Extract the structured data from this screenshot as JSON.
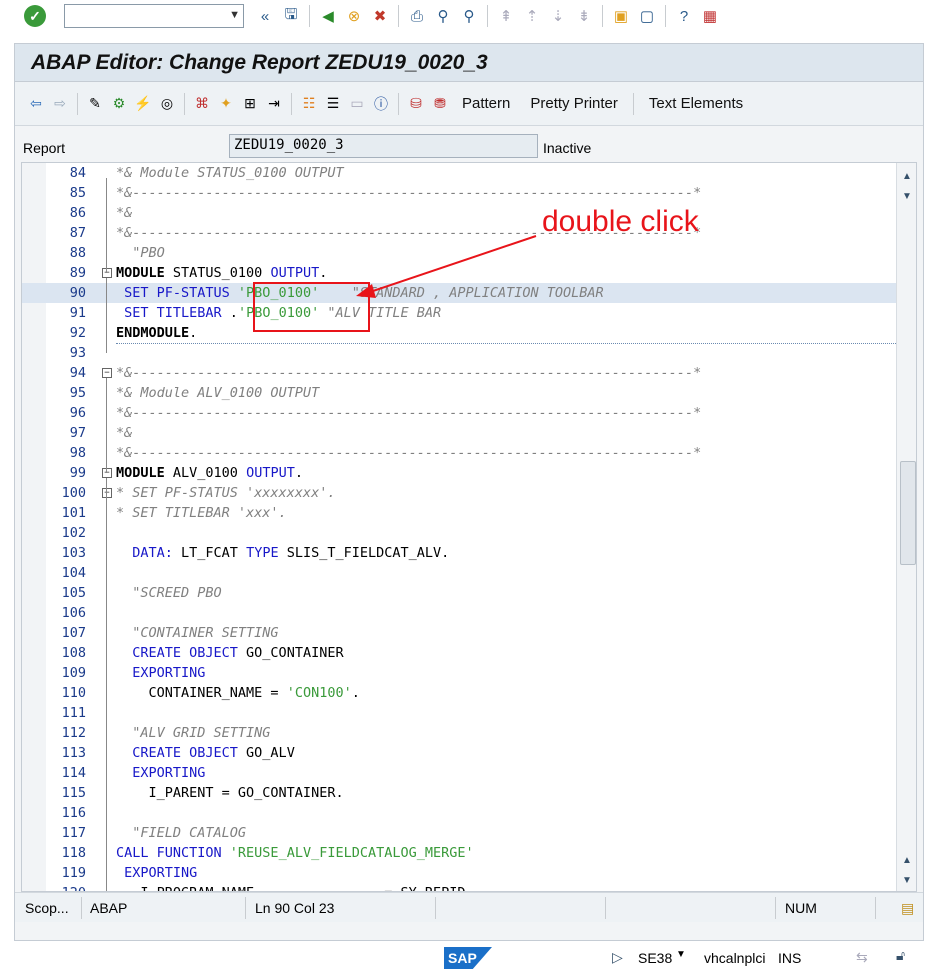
{
  "topbar": {
    "command_value": ""
  },
  "window": {
    "title": "ABAP Editor: Change Report ZEDU19_0020_3"
  },
  "toolbar": {
    "pattern": "Pattern",
    "pretty_printer": "Pretty Printer",
    "text_elements": "Text Elements"
  },
  "report": {
    "label": "Report",
    "value": "ZEDU19_0020_3",
    "status": "Inactive"
  },
  "lines": [
    {
      "n": "84",
      "text": "*& Module STATUS_0100 OUTPUT"
    },
    {
      "n": "85",
      "text": "*&---------------------------------------------------------------------*"
    },
    {
      "n": "86",
      "text": "*&"
    },
    {
      "n": "87",
      "text": "*&---------------------------------------------------------------------*"
    },
    {
      "n": "88",
      "text": "  \"PBO"
    },
    {
      "n": "89",
      "a": "MODULE",
      "b": " STATUS_0100 ",
      "c": "OUTPUT",
      "d": "."
    },
    {
      "n": "90",
      "a": " SET PF-STATUS ",
      "s": "'PBO_0100'",
      "cm": "    \"STANDARD , APPLICATION TOOLBAR"
    },
    {
      "n": "91",
      "a": " SET TITLEBAR ",
      "s": "'PBO_0100'",
      "d": ".",
      "cm": " \"ALV TITLE BAR"
    },
    {
      "n": "92",
      "a": "ENDMODULE",
      "d": "."
    },
    {
      "n": "93"
    },
    {
      "n": "94",
      "text": "*&---------------------------------------------------------------------*"
    },
    {
      "n": "95",
      "text": "*& Module ALV_0100 OUTPUT"
    },
    {
      "n": "96",
      "text": "*&---------------------------------------------------------------------*"
    },
    {
      "n": "97",
      "text": "*&"
    },
    {
      "n": "98",
      "text": "*&---------------------------------------------------------------------*"
    },
    {
      "n": "99",
      "a": "MODULE",
      "b": " ALV_0100 ",
      "c": "OUTPUT",
      "d": "."
    },
    {
      "n": "100",
      "text": "* SET PF-STATUS 'xxxxxxxx'."
    },
    {
      "n": "101",
      "text": "* SET TITLEBAR 'xxx'."
    },
    {
      "n": "102"
    },
    {
      "n": "103",
      "a": "  DATA:",
      "b": " LT_FCAT ",
      "c": "TYPE",
      "d": " SLIS_T_FIELDCAT_ALV."
    },
    {
      "n": "104"
    },
    {
      "n": "105",
      "text": "  \"SCREED PBO"
    },
    {
      "n": "106"
    },
    {
      "n": "107",
      "text": "  \"CONTAINER SETTING"
    },
    {
      "n": "108",
      "a": "  CREATE OBJECT",
      "d": " GO_CONTAINER"
    },
    {
      "n": "109",
      "a": "  EXPORTING"
    },
    {
      "n": "110",
      "d": "    CONTAINER_NAME = ",
      "s": "'CON100'",
      "e": "."
    },
    {
      "n": "111"
    },
    {
      "n": "112",
      "text": "  \"ALV GRID SETTING"
    },
    {
      "n": "113",
      "a": "  CREATE OBJECT",
      "d": " GO_ALV"
    },
    {
      "n": "114",
      "a": "  EXPORTING"
    },
    {
      "n": "115",
      "d": "    I_PARENT = GO_CONTAINER."
    },
    {
      "n": "116"
    },
    {
      "n": "117",
      "text": "  \"FIELD CATALOG"
    },
    {
      "n": "118",
      "a": "CALL FUNCTION ",
      "s": "'REUSE_ALV_FIELDCATALOG_MERGE'"
    },
    {
      "n": "119",
      "a": " EXPORTING"
    },
    {
      "n": "120",
      "d": "   I_PROGRAM_NAME                = SY-REPID"
    }
  ],
  "status": {
    "scope": "Scop...",
    "lang": "ABAP",
    "pos": "Ln  90 Col  23",
    "num": "NUM"
  },
  "bottom": {
    "tcode": "SE38",
    "server": "vhcalnplci",
    "mode": "INS",
    "sap": "SAP"
  },
  "annotation": {
    "text": "double click"
  }
}
